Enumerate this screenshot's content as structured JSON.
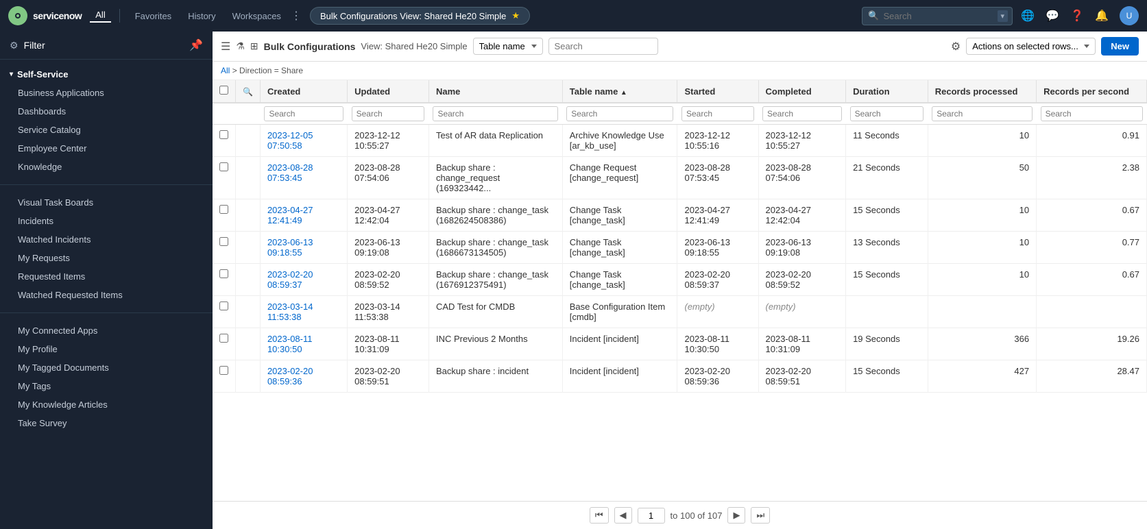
{
  "topNav": {
    "logoText": "servicenow",
    "allLabel": "All",
    "favorites": "Favorites",
    "history": "History",
    "workspaces": "Workspaces",
    "centerTitle": "Bulk Configurations View: Shared He20 Simple",
    "searchPlaceholder": "Search"
  },
  "sidebar": {
    "filterLabel": "Filter",
    "sections": [
      {
        "name": "Self-Service",
        "expanded": true,
        "items": [
          "Business Applications",
          "Dashboards",
          "Service Catalog",
          "Employee Center",
          "Knowledge"
        ]
      },
      {
        "name": "",
        "expanded": true,
        "items": [
          "Visual Task Boards",
          "Incidents",
          "Watched Incidents",
          "My Requests",
          "Requested Items",
          "Watched Requested Items"
        ]
      },
      {
        "name": "",
        "expanded": true,
        "items": [
          "My Connected Apps",
          "My Profile",
          "My Tagged Documents",
          "My Tags",
          "My Knowledge Articles",
          "Take Survey"
        ]
      }
    ]
  },
  "toolbar": {
    "title": "Bulk Configurations",
    "viewLabel": "View: Shared He20 Simple",
    "tableNamePlaceholder": "Table name",
    "searchPlaceholder": "Search",
    "actionsLabel": "Actions on selected rows...",
    "newButton": "New"
  },
  "breadcrumb": {
    "allLabel": "All",
    "separator": ">",
    "filter": "Direction = Share"
  },
  "table": {
    "columns": [
      "",
      "",
      "Created",
      "Updated",
      "Name",
      "Table name",
      "Started",
      "Completed",
      "Duration",
      "Records processed",
      "Records per second"
    ],
    "rows": [
      {
        "created": "2023-12-05 07:50:58",
        "updated": "2023-12-12 10:55:27",
        "name": "Test of AR data Replication",
        "tableName": "Archive Knowledge Use [ar_kb_use]",
        "started": "2023-12-12 10:55:16",
        "completed": "2023-12-12 10:55:27",
        "duration": "11 Seconds",
        "recordsProcessed": "10",
        "recordsPerSecond": "0.91"
      },
      {
        "created": "2023-08-28 07:53:45",
        "updated": "2023-08-28 07:54:06",
        "name": "Backup share : change_request (169323442...",
        "tableName": "Change Request [change_request]",
        "started": "2023-08-28 07:53:45",
        "completed": "2023-08-28 07:54:06",
        "duration": "21 Seconds",
        "recordsProcessed": "50",
        "recordsPerSecond": "2.38"
      },
      {
        "created": "2023-04-27 12:41:49",
        "updated": "2023-04-27 12:42:04",
        "name": "Backup share : change_task (1682624508386)",
        "tableName": "Change Task [change_task]",
        "started": "2023-04-27 12:41:49",
        "completed": "2023-04-27 12:42:04",
        "duration": "15 Seconds",
        "recordsProcessed": "10",
        "recordsPerSecond": "0.67"
      },
      {
        "created": "2023-06-13 09:18:55",
        "updated": "2023-06-13 09:19:08",
        "name": "Backup share : change_task (1686673134505)",
        "tableName": "Change Task [change_task]",
        "started": "2023-06-13 09:18:55",
        "completed": "2023-06-13 09:19:08",
        "duration": "13 Seconds",
        "recordsProcessed": "10",
        "recordsPerSecond": "0.77"
      },
      {
        "created": "2023-02-20 08:59:37",
        "updated": "2023-02-20 08:59:52",
        "name": "Backup share : change_task (1676912375491)",
        "tableName": "Change Task [change_task]",
        "started": "2023-02-20 08:59:37",
        "completed": "2023-02-20 08:59:52",
        "duration": "15 Seconds",
        "recordsProcessed": "10",
        "recordsPerSecond": "0.67"
      },
      {
        "created": "2023-03-14 11:53:38",
        "updated": "2023-03-14 11:53:38",
        "name": "CAD Test for CMDB",
        "tableName": "Base Configuration Item [cmdb]",
        "started": "(empty)",
        "completed": "(empty)",
        "duration": "",
        "recordsProcessed": "",
        "recordsPerSecond": ""
      },
      {
        "created": "2023-08-11 10:30:50",
        "updated": "2023-08-11 10:31:09",
        "name": "INC Previous 2 Months",
        "tableName": "Incident [incident]",
        "started": "2023-08-11 10:30:50",
        "completed": "2023-08-11 10:31:09",
        "duration": "19 Seconds",
        "recordsProcessed": "366",
        "recordsPerSecond": "19.26"
      },
      {
        "created": "2023-02-20 08:59:36",
        "updated": "2023-02-20 08:59:51",
        "name": "Backup share : incident",
        "tableName": "Incident [incident]",
        "started": "2023-02-20 08:59:36",
        "completed": "2023-02-20 08:59:51",
        "duration": "15 Seconds",
        "recordsProcessed": "427",
        "recordsPerSecond": "28.47"
      }
    ]
  },
  "pagination": {
    "currentPage": "1",
    "pageSize": "100",
    "total": "107",
    "pageInfo": "to 100 of 107"
  }
}
